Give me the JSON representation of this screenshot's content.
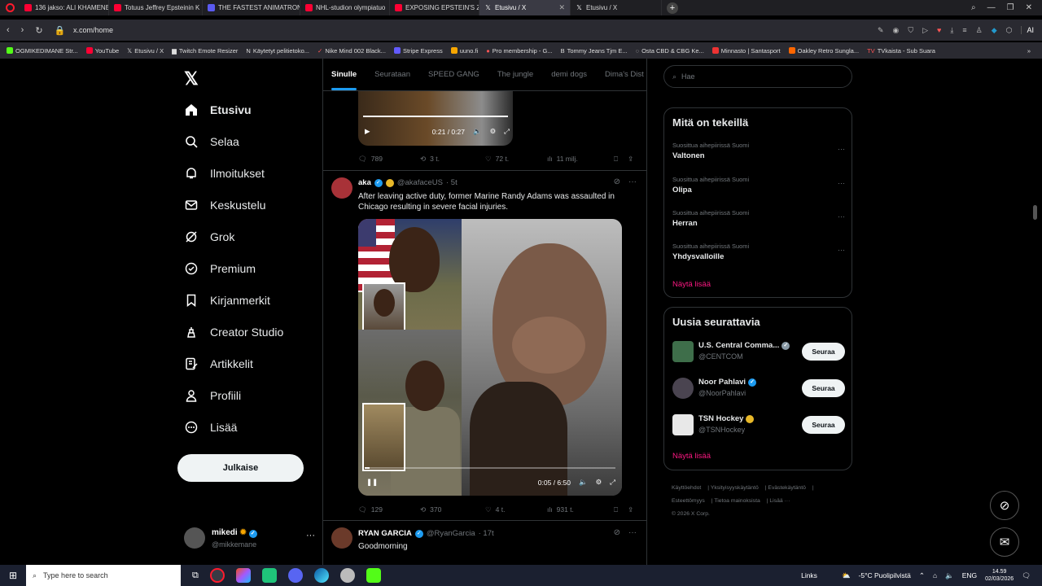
{
  "browser": {
    "tabs": [
      {
        "label": "136 jakso: ALI KHAMENEI",
        "icon": "youtube"
      },
      {
        "label": "Totuus Jeffrey Epsteinin K",
        "icon": "youtube"
      },
      {
        "label": "THE FASTEST ANIMATRON",
        "icon": "twitch"
      },
      {
        "label": "NHL-studion olympiatuo",
        "icon": "youtube"
      },
      {
        "label": "EXPOSING EPSTEIN'S ZOR",
        "icon": "youtube"
      },
      {
        "label": "Etusivu / X",
        "icon": "x",
        "active": true
      },
      {
        "label": "Etusivu / X",
        "icon": "x"
      }
    ],
    "url": "x.com/home",
    "ai_label": "AI",
    "bookmarks": [
      "OGMIKEDIMANE Str...",
      "YouTube",
      "Etusivu / X",
      "Twitch Emote Resizer",
      "Käytetyt pelitietoko...",
      "Nike Mind 002 Black...",
      "Stripe Express",
      "uuno.fi",
      "Pro membership - G...",
      "Tommy Jeans Tjm E...",
      "Osta CBD & CBG Ke...",
      "Minnasto | Santasport",
      "Oakley Retro Sungla...",
      "TVkaista - Sub Suara"
    ]
  },
  "nav": {
    "items": [
      {
        "label": "Etusivu",
        "icon": "home-icon"
      },
      {
        "label": "Selaa",
        "icon": "search-icon"
      },
      {
        "label": "Ilmoitukset",
        "icon": "bell-icon"
      },
      {
        "label": "Keskustelu",
        "icon": "mail-icon"
      },
      {
        "label": "Grok",
        "icon": "grok-icon"
      },
      {
        "label": "Premium",
        "icon": "premium-icon"
      },
      {
        "label": "Kirjanmerkit",
        "icon": "bookmark-icon"
      },
      {
        "label": "Creator Studio",
        "icon": "creator-icon"
      },
      {
        "label": "Artikkelit",
        "icon": "article-icon"
      },
      {
        "label": "Profiili",
        "icon": "person-icon"
      },
      {
        "label": "Lisää",
        "icon": "more-icon"
      }
    ],
    "post_button": "Julkaise",
    "profile": {
      "name": "mikedi",
      "handle": "@mikkemane"
    }
  },
  "feed": {
    "tabs": [
      "Sinulle",
      "Seurataan",
      "SPEED GANG",
      "The jungle",
      "demi dogs",
      "Dima's Dist"
    ],
    "prev_video_time": "0:21 / 0:27",
    "prev_actions": {
      "replies": "789",
      "reposts": "3 t.",
      "likes": "72 t.",
      "views": "11 milj."
    },
    "tweet": {
      "name": "aka",
      "handle": "@akafaceUS",
      "time": "· 5t",
      "text": "After leaving active duty, former Marine Randy Adams was assaulted in Chicago resulting in severe facial injuries.",
      "video_time": "0:05 / 6:50",
      "actions": {
        "replies": "129",
        "reposts": "370",
        "likes": "4 t.",
        "views": "931 t."
      }
    },
    "next_tweet": {
      "name": "RYAN GARCIA",
      "handle": "@RyanGarcia",
      "time": "· 17t",
      "text": "Goodmorning"
    }
  },
  "sidebar": {
    "search_placeholder": "Hae",
    "trending_title": "Mitä on tekeillä",
    "trends": [
      {
        "context": "Suosittua aihepiirissä Suomi",
        "name": "Valtonen"
      },
      {
        "context": "Suosittua aihepiirissä Suomi",
        "name": "Olipa"
      },
      {
        "context": "Suosittua aihepiirissä Suomi",
        "name": "Herran"
      },
      {
        "context": "Suosittua aihepiirissä Suomi",
        "name": "Yhdysvalloille"
      }
    ],
    "show_more": "Näytä lisää",
    "follow_title": "Uusia seurattavia",
    "follows": [
      {
        "name": "U.S. Central Comma...",
        "handle": "@CENTCOM",
        "button": "Seuraa"
      },
      {
        "name": "Noor Pahlavi",
        "handle": "@NoorPahlavi",
        "button": "Seuraa"
      },
      {
        "name": "TSN Hockey",
        "handle": "@TSNHockey",
        "button": "Seuraa"
      }
    ],
    "footer": [
      "Käyttöehdot",
      "Yksityisyyskäytäntö",
      "Evästekäytäntö",
      "Esteettömyys",
      "Tietoa mainoksista",
      "Lisää ···",
      "© 2026 X Corp."
    ]
  },
  "taskbar": {
    "search_placeholder": "Type here to search",
    "links": "Links",
    "weather": "-5°C  Puolipilvistä",
    "lang": "ENG",
    "time": "14.59",
    "date": "02/03/2026"
  },
  "colors": {
    "accent": "#1d9bf0",
    "pink": "#f91880",
    "bg": "#000000"
  }
}
